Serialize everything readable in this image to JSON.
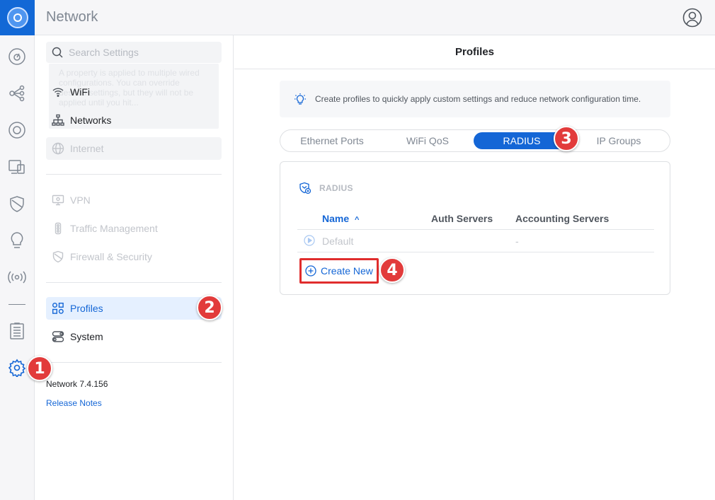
{
  "app": {
    "title": "Network"
  },
  "search": {
    "placeholder": "Search Settings"
  },
  "tooltip": {
    "text": "A property is applied to multiple wired configurations. You can override desired settings, but they will not be applied until you hit..."
  },
  "sidebar": {
    "items": [
      {
        "label": "WiFi",
        "state": "normal"
      },
      {
        "label": "Networks",
        "state": "normal"
      },
      {
        "label": "Internet",
        "state": "disabled"
      },
      {
        "label": "VPN",
        "state": "disabled"
      },
      {
        "label": "Traffic Management",
        "state": "disabled"
      },
      {
        "label": "Firewall & Security",
        "state": "disabled"
      },
      {
        "label": "Profiles",
        "state": "active"
      },
      {
        "label": "System",
        "state": "normal"
      }
    ],
    "version": "Network 7.4.156",
    "release_notes": "Release Notes"
  },
  "main": {
    "title": "Profiles",
    "info": "Create profiles to quickly apply custom settings and reduce network configuration time.",
    "tabs": [
      {
        "label": "Ethernet Ports",
        "active": false
      },
      {
        "label": "WiFi QoS",
        "active": false
      },
      {
        "label": "RADIUS",
        "active": true
      },
      {
        "label": "IP Groups",
        "active": false
      }
    ],
    "card": {
      "title": "RADIUS",
      "columns": {
        "name": "Name",
        "auth": "Auth Servers",
        "accounting": "Accounting Servers"
      },
      "rows": [
        {
          "name": "Default",
          "auth": "",
          "accounting": "-"
        }
      ],
      "create_label": "Create New"
    }
  },
  "badges": [
    "1",
    "2",
    "3",
    "4"
  ],
  "colors": {
    "accent": "#1466d6",
    "badge": "#e23b3b",
    "highlight_border": "#e02d2d"
  }
}
